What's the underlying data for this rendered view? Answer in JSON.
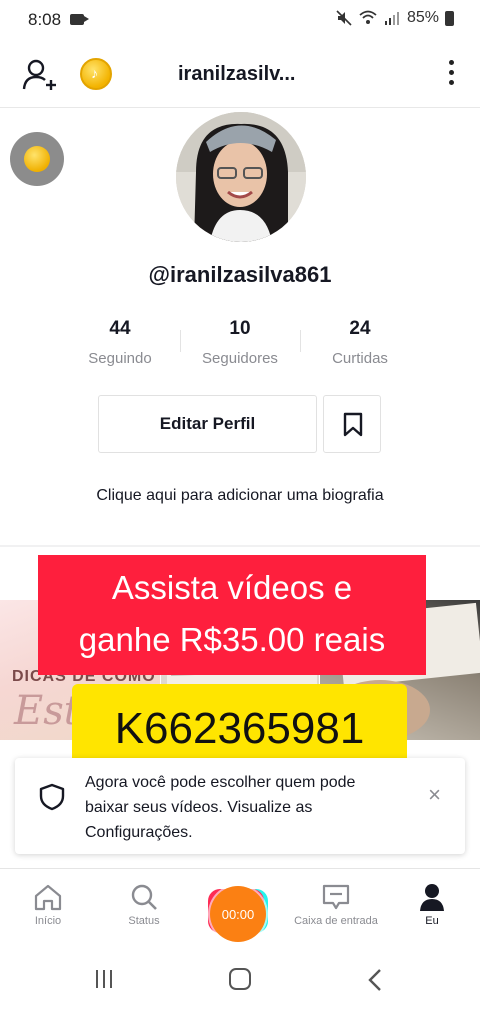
{
  "status_bar": {
    "time": "8:08",
    "battery": "85%"
  },
  "header": {
    "title": "iranilzasilv...",
    "coin_glyph": "♪"
  },
  "profile": {
    "username": "@iranilzasilva861",
    "stats": [
      {
        "value": "44",
        "label": "Seguindo"
      },
      {
        "value": "10",
        "label": "Seguidores"
      },
      {
        "value": "24",
        "label": "Curtidas"
      }
    ],
    "edit_label": "Editar Perfil",
    "bio_prompt": "Clique aqui para adicionar uma biografia"
  },
  "videos": {
    "thumb1_title": "DICAS DE COMO",
    "thumb1_script": "Estu"
  },
  "promo": {
    "line1": "Assista vídeos e",
    "line2": "ganhe R$35.00 reais",
    "code": "K662365981",
    "colors": {
      "red": "#fe1f3d",
      "yellow": "#ffe500"
    }
  },
  "notice": {
    "text": "Agora você pode escolher quem pode baixar seus vídeos. Visualize as Configurações.",
    "close": "×"
  },
  "tabbar": {
    "home": "Início",
    "status": "Status",
    "timer": "00:00",
    "inbox": "Caixa de entrada",
    "me": "Eu"
  },
  "icons": [
    "add-user-icon",
    "coin-icon",
    "more-icon",
    "bookmark-icon",
    "shield-icon",
    "close-icon",
    "home-icon",
    "search-icon",
    "inbox-icon",
    "profile-icon",
    "recents-icon",
    "home-circle-icon",
    "back-icon"
  ]
}
